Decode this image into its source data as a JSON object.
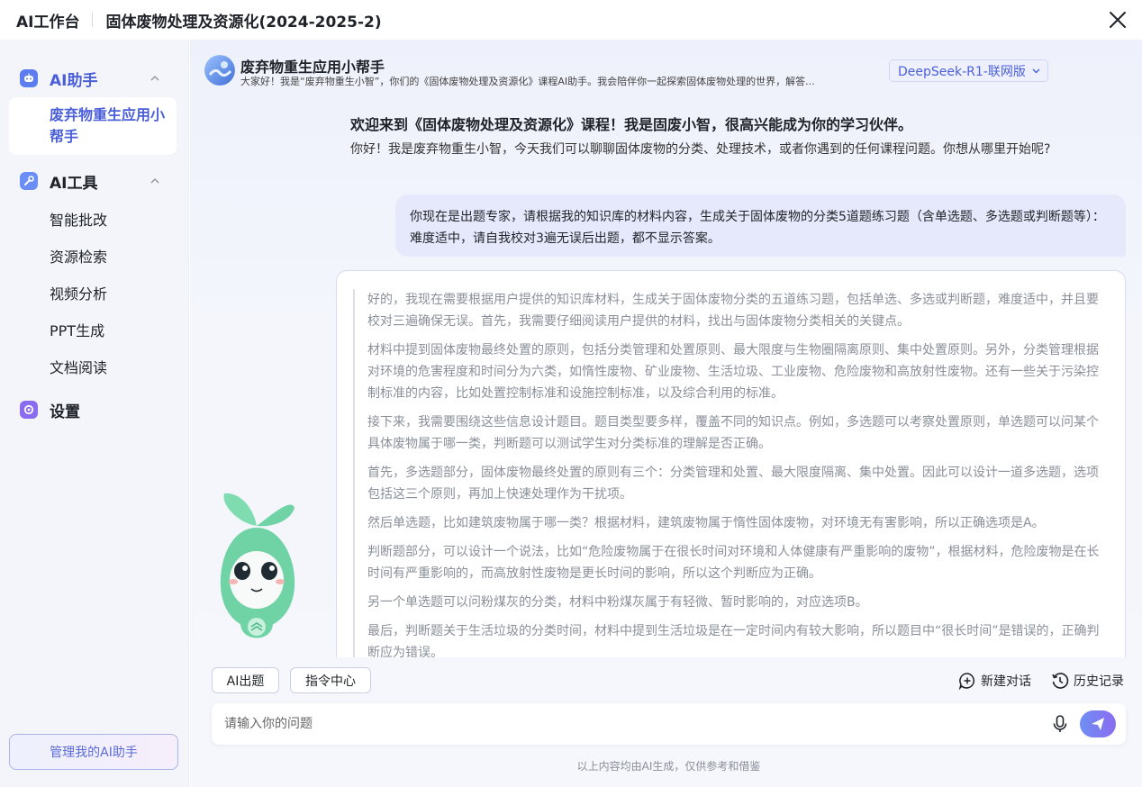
{
  "app": {
    "title": "AI工作台",
    "course_title": "固体废物处理及资源化(2024-2025-2)"
  },
  "sidebar": {
    "ai_assistant_group": "AI助手",
    "active_assistant": "废弃物重生应用小帮手",
    "ai_tools_group": "AI工具",
    "tools": [
      "智能批改",
      "资源检索",
      "视频分析",
      "PPT生成",
      "文档阅读"
    ],
    "settings": "设置",
    "manage_button": "管理我的AI助手"
  },
  "bot": {
    "name": "废弃物重生应用小帮手",
    "description": "大家好！我是“废弃物重生小智”，你们的《固体废物处理及资源化》课程AI助手。我会陪伴你一起探索固体废物处理的世界，解答..."
  },
  "model_selector": {
    "value": "DeepSeek-R1-联网版"
  },
  "chat": {
    "welcome_title": "欢迎来到《固体废物处理及资源化》课程！我是固废小智，很高兴能成为你的学习伙伴。",
    "welcome_text": "你好！我是废弃物重生小智，今天我们可以聊聊固体废物的分类、处理技术，或者你遇到的任何课程问题。你想从哪里开始呢?",
    "user_message": "你现在是出题专家，请根据我的知识库的材料内容，生成关于固体废物的分类5道题练习题（含单选题、多选题或判断题等）：难度适中，请自我校对3遍无误后出题，都不显示答案。",
    "thinking": [
      "好的，我现在需要根据用户提供的知识库材料，生成关于固体废物分类的五道练习题，包括单选、多选或判断题，难度适中，并且要校对三遍确保无误。首先，我需要仔细阅读用户提供的材料，找出与固体废物分类相关的关键点。",
      "材料中提到固体废物最终处置的原则，包括分类管理和处置原则、最大限度与生物圈隔离原则、集中处置原则。另外，分类管理根据对环境的危害程度和时间分为六类，如惰性废物、矿业废物、生活垃圾、工业废物、危险废物和高放射性废物。还有一些关于污染控制标准的内容，比如处置控制标准和设施控制标准，以及综合利用的标准。",
      "接下来，我需要围绕这些信息设计题目。题目类型要多样，覆盖不同的知识点。例如，多选题可以考察处置原则，单选题可以问某个具体废物属于哪一类，判断题可以测试学生对分类标准的理解是否正确。",
      "首先，多选题部分，固体废物最终处置的原则有三个：分类管理和处置、最大限度隔离、集中处置。因此可以设计一道多选题，选项包括这三个原则，再加上快速处理作为干扰项。",
      "然后单选题，比如建筑废物属于哪一类？根据材料，建筑废物属于惰性固体废物，对环境无有害影响，所以正确选项是A。",
      "判断题部分，可以设计一个说法，比如“危险废物属于在很长时间对环境和人体健康有严重影响的废物”，根据材料，危险废物是在长时间有严重影响的，而高放射性废物是更长时间的影响，所以这个判断应为正确。",
      "另一个单选题可以问粉煤灰的分类，材料中粉煤灰属于有轻微、暂时影响的，对应选项B。",
      "最后，判断题关于生活垃圾的分类时间，材料中提到生活垃圾是在一定时间内有较大影响，所以题目中“很长时间”是错误的，正确判断应为错误。"
    ]
  },
  "toolbar": {
    "ai_question_chip": "AI出题",
    "command_center_chip": "指令中心",
    "new_chat": "新建对话",
    "history": "历史记录"
  },
  "input": {
    "placeholder": "请输入你的问题"
  },
  "footer": {
    "disclaimer": "以上内容均由AI生成，仅供参考和借鉴"
  },
  "colors": {
    "accent": "#4a5fd8",
    "sidebar_bg": "#f3f5fa",
    "user_bubble": "#e6e9fb",
    "mascot_green": "#6fd3a6"
  }
}
